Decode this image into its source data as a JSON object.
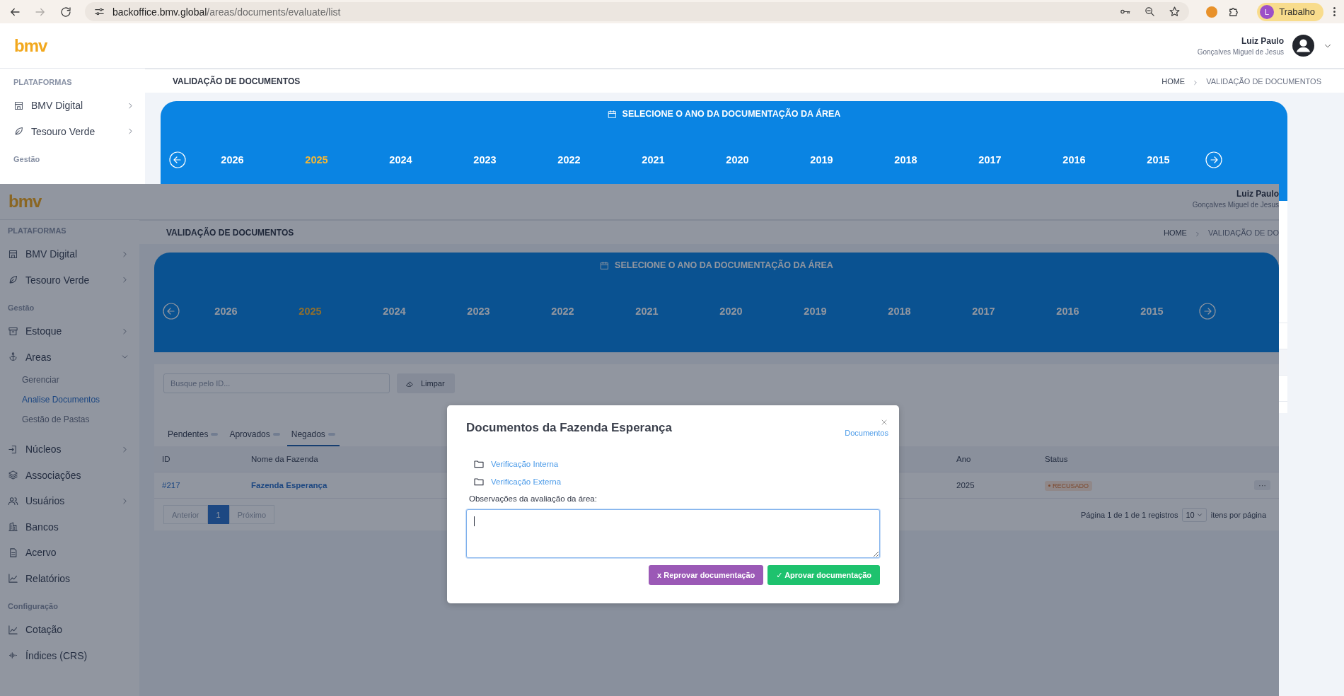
{
  "browser": {
    "url_host": "backoffice.bmv.global",
    "url_path": "/areas/documents/evaluate/list",
    "forward_disabled": true,
    "profile": {
      "initial": "L",
      "name": "Trabalho"
    }
  },
  "background_page": {
    "logo": "bmv",
    "user": {
      "name": "Luiz Paulo",
      "subtitle": "Gonçalves Miguel de Jesus"
    },
    "sidebar": {
      "sections": [
        {
          "heading": "PLATAFORMAS",
          "items": [
            {
              "label": "BMV Digital",
              "expanded": false
            },
            {
              "label": "Tesouro Verde",
              "expanded": false
            }
          ]
        },
        {
          "heading": "Gestão"
        }
      ]
    },
    "page_title": "VALIDAÇÃO DE DOCUMENTOS",
    "breadcrumbs": [
      "HOME",
      "VALIDAÇÃO DE DOCUMENTOS"
    ],
    "year_picker": {
      "title": "SELECIONE O ANO DA DOCUMENTAÇÃO DA ÁREA",
      "years": [
        {
          "label": "2026",
          "selected": false
        },
        {
          "label": "2025",
          "selected": true
        },
        {
          "label": "2024",
          "selected": false
        },
        {
          "label": "2023",
          "selected": false
        },
        {
          "label": "2022",
          "selected": false
        },
        {
          "label": "2021",
          "selected": false
        },
        {
          "label": "2020",
          "selected": false
        },
        {
          "label": "2019",
          "selected": false
        },
        {
          "label": "2018",
          "selected": false
        },
        {
          "label": "2017",
          "selected": false
        },
        {
          "label": "2016",
          "selected": false
        },
        {
          "label": "2015",
          "selected": false
        }
      ]
    }
  },
  "overlay_page": {
    "logo": "bmv",
    "user": {
      "name": "Luiz Paulo",
      "subtitle": "Gonçalves Miguel de Jesus"
    },
    "sidebar": {
      "sections": [
        {
          "heading": "PLATAFORMAS",
          "items": [
            {
              "label": "BMV Digital",
              "expanded": false
            },
            {
              "label": "Tesouro Verde",
              "expanded": false
            }
          ]
        },
        {
          "heading": "Gestão",
          "items": [
            {
              "label": "Estoque",
              "expanded": false
            },
            {
              "label": "Areas",
              "expanded": true,
              "children": [
                {
                  "label": "Gerenciar",
                  "selected": false
                },
                {
                  "label": "Analise Documentos",
                  "selected": true
                },
                {
                  "label": "Gestão de Pastas",
                  "selected": false
                }
              ]
            },
            {
              "label": "Núcleos",
              "expanded": false
            },
            {
              "label": "Associações"
            },
            {
              "label": "Usuários",
              "expanded": false
            },
            {
              "label": "Bancos"
            },
            {
              "label": "Acervo"
            },
            {
              "label": "Relatórios"
            }
          ]
        },
        {
          "heading": "Configuração",
          "items": [
            {
              "label": "Cotação"
            },
            {
              "label": "Índices (CRS)"
            }
          ]
        }
      ]
    },
    "page_title": "VALIDAÇÃO DE DOCUMENTOS",
    "breadcrumbs": [
      "HOME",
      "VALIDAÇÃO DE DO"
    ],
    "year_picker": {
      "title": "SELECIONE O ANO DA DOCUMENTAÇÃO DA ÁREA",
      "years": [
        {
          "label": "2026",
          "selected": false
        },
        {
          "label": "2025",
          "selected": true
        },
        {
          "label": "2024",
          "selected": false
        },
        {
          "label": "2023",
          "selected": false
        },
        {
          "label": "2022",
          "selected": false
        },
        {
          "label": "2021",
          "selected": false
        },
        {
          "label": "2020",
          "selected": false
        },
        {
          "label": "2019",
          "selected": false
        },
        {
          "label": "2018",
          "selected": false
        },
        {
          "label": "2017",
          "selected": false
        },
        {
          "label": "2016",
          "selected": false
        },
        {
          "label": "2015",
          "selected": false
        }
      ]
    },
    "search": {
      "placeholder": "Busque pelo ID...",
      "clear_button": "Limpar"
    },
    "tabs": [
      {
        "label": "Pendentes",
        "selected": false
      },
      {
        "label": "Aprovados",
        "selected": false
      },
      {
        "label": "Negados",
        "selected": true
      }
    ],
    "table": {
      "columns": [
        "ID",
        "Nome da Fazenda",
        "Ano",
        "Status"
      ],
      "rows": [
        {
          "id": "#217",
          "farm": "Fazenda Esperança",
          "year": "2025",
          "status": {
            "label": "RECUSADO",
            "kind": "rejected"
          },
          "actions": "···"
        }
      ]
    },
    "pagination": {
      "previous": {
        "label": "Anterior",
        "disabled": true
      },
      "pages": [
        {
          "label": "1",
          "selected": true
        }
      ],
      "next": {
        "label": "Próximo",
        "disabled": true
      },
      "summary": "Página 1 de 1 de 1 registros",
      "page_size": "10",
      "page_size_label": "itens por página"
    },
    "modal": {
      "title": "Documentos da Fazenda Esperança",
      "link": "Documentos",
      "folders": [
        "Verificação Interna",
        "Verificação Externa"
      ],
      "notes_label": "Observações da avaliação da área:",
      "notes_focused": true,
      "reject_button": "x Reprovar documentação",
      "approve_button": "✓ Aprovar documentação"
    }
  }
}
